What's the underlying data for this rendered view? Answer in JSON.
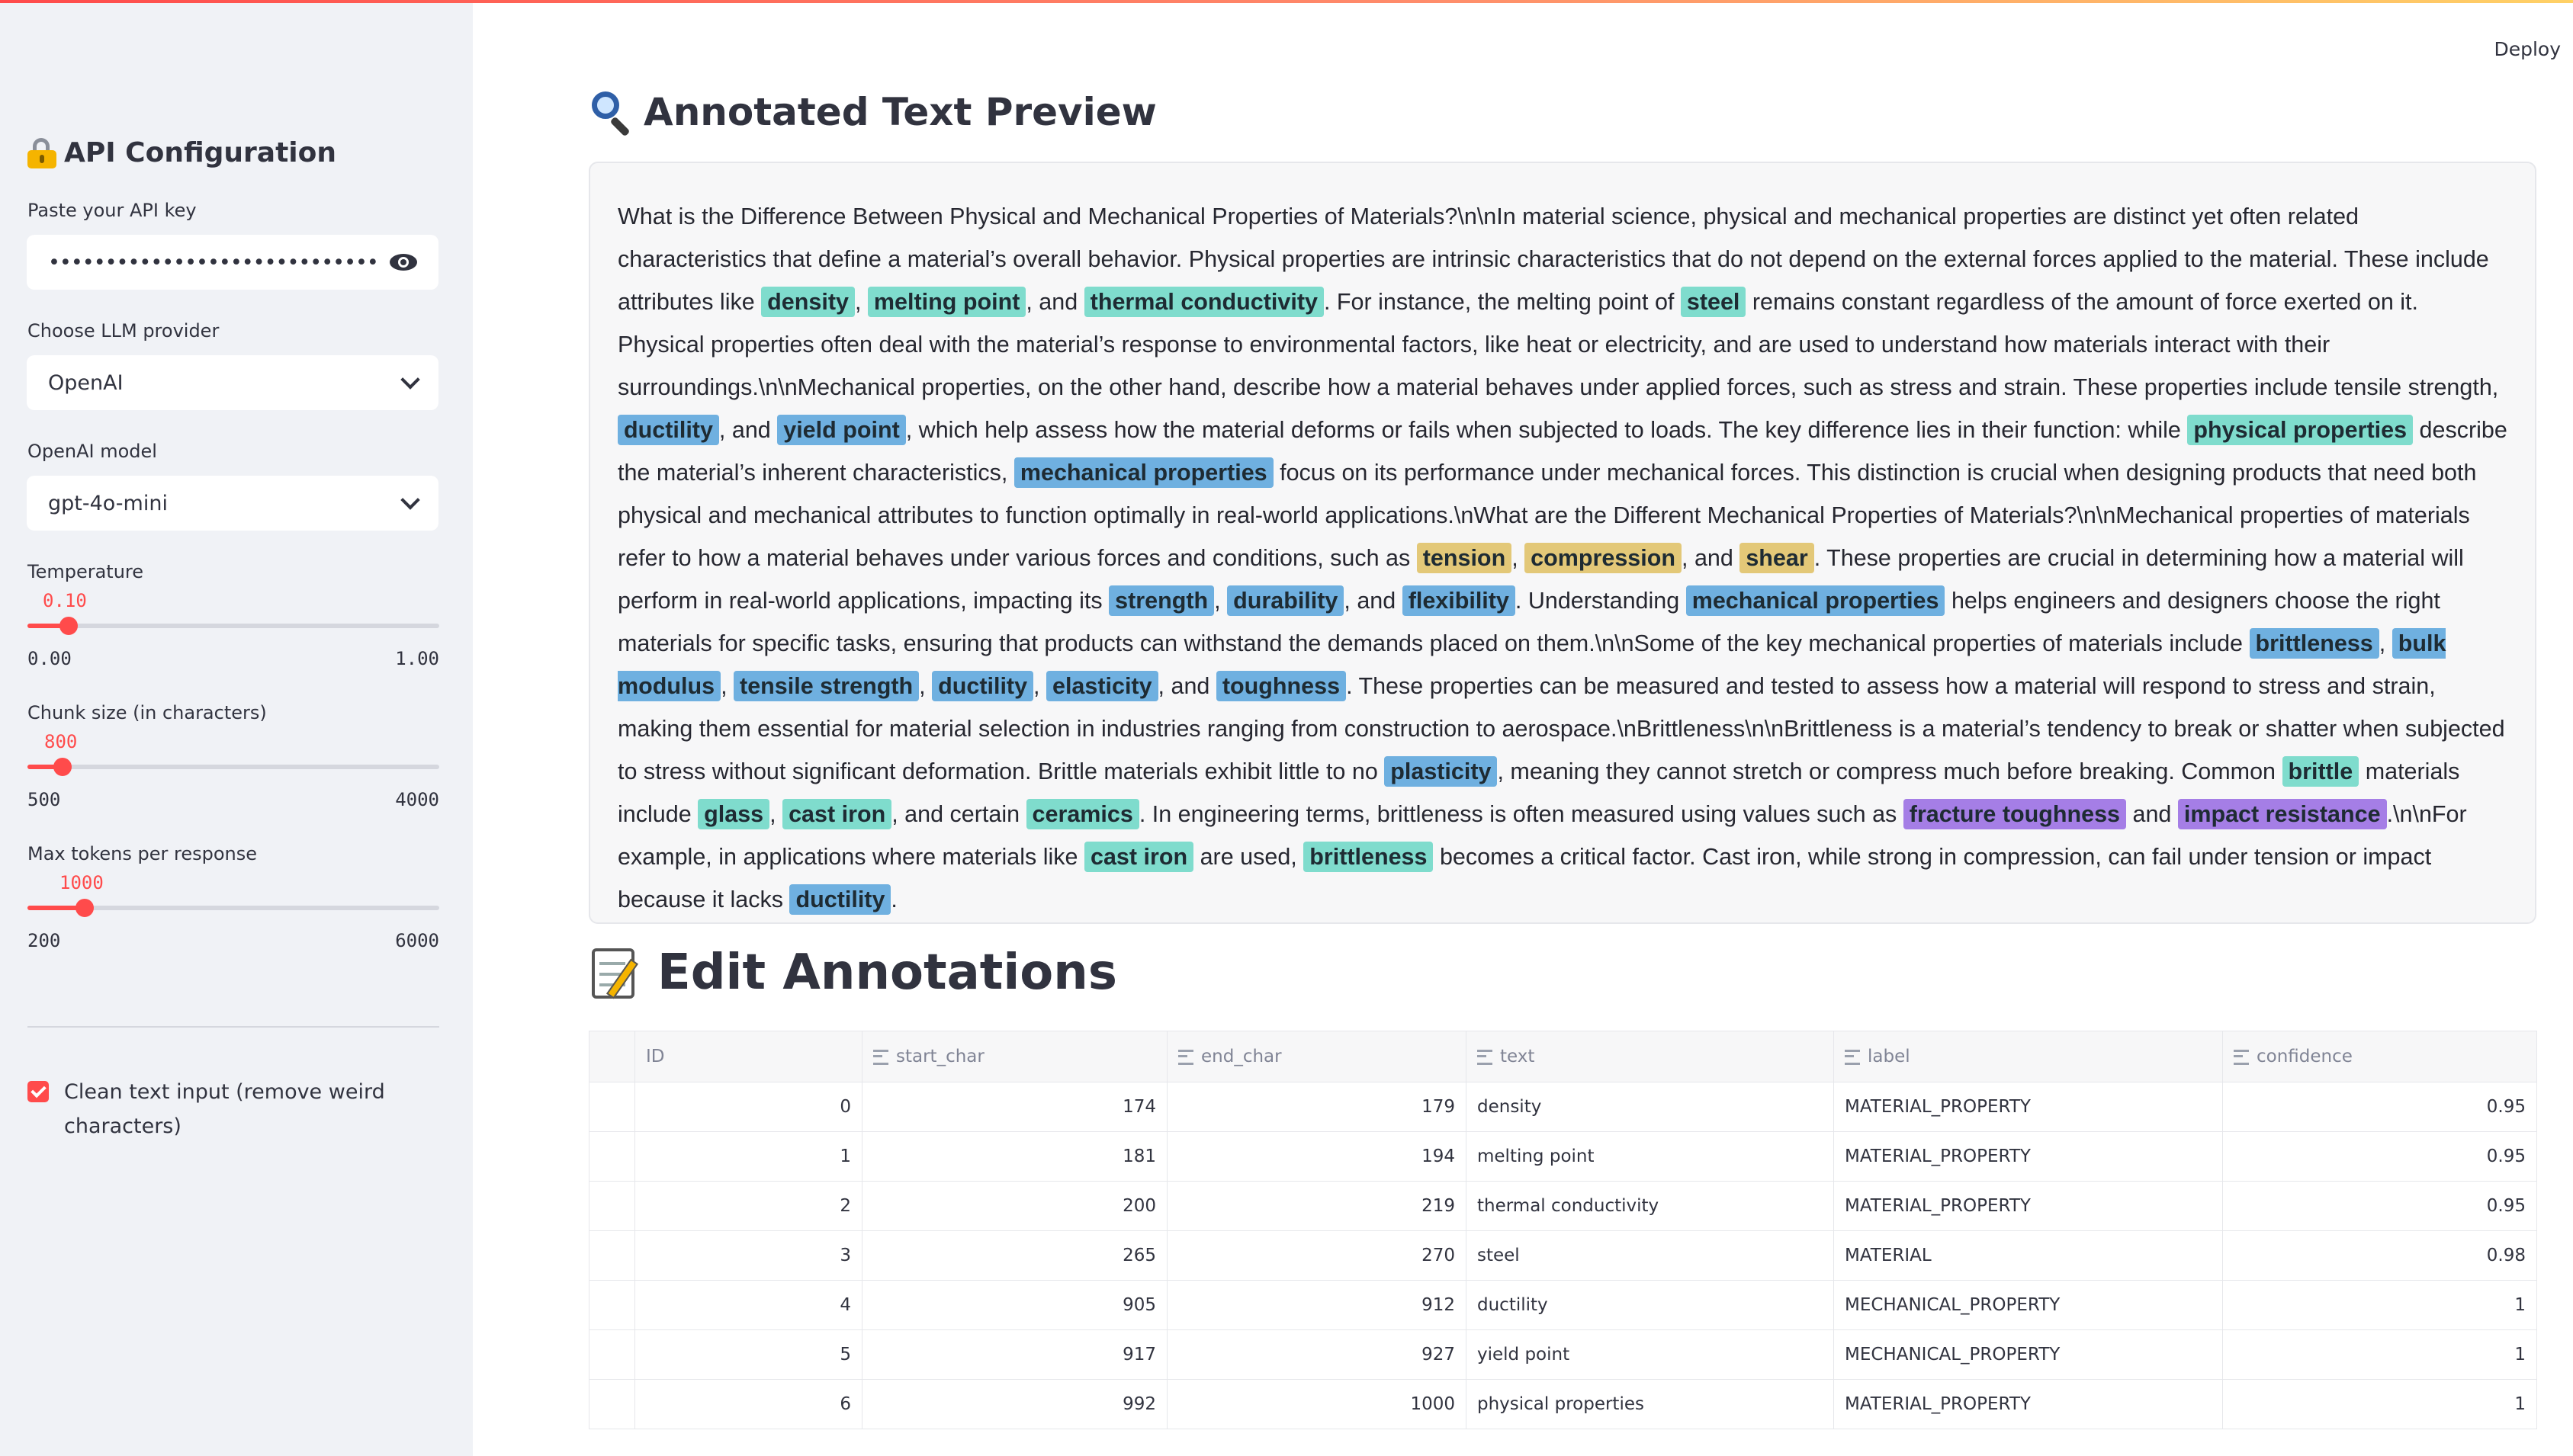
{
  "app": {
    "deploy_label": "Deploy"
  },
  "sidebar": {
    "title": "API Configuration",
    "api_key": {
      "label": "Paste your API key",
      "value": "••••••••••••••••••••••••••••••••••••••••••••••••••••"
    },
    "provider": {
      "label": "Choose LLM provider",
      "value": "OpenAI"
    },
    "model": {
      "label": "OpenAI model",
      "value": "gpt-4o-mini"
    },
    "temperature": {
      "label": "Temperature",
      "value": "0.10",
      "min": "0.00",
      "max": "1.00",
      "fraction": 0.1
    },
    "chunk_size": {
      "label": "Chunk size (in characters)",
      "value": "800",
      "min": "500",
      "max": "4000",
      "fraction": 0.0857
    },
    "max_tokens": {
      "label": "Max tokens per response",
      "value": "1000",
      "min": "200",
      "max": "6000",
      "fraction": 0.138
    },
    "clean_text": {
      "label": "Clean text input (remove weird characters)",
      "checked": true
    }
  },
  "preview": {
    "title": "Annotated Text Preview",
    "segments": [
      [
        "What is the Difference Between Physical and Mechanical Properties of Materials?\\n\\nIn material science, physical and mechanical properties are distinct yet often related characteristics that define a material’s overall behavior. Physical properties are intrinsic characteristics that do not depend on the external forces applied to the material. These include attributes like ",
        ""
      ],
      [
        "density",
        "mp"
      ],
      [
        ", ",
        ""
      ],
      [
        "melting point",
        "mp"
      ],
      [
        ", and ",
        ""
      ],
      [
        "thermal conductivity",
        "mp"
      ],
      [
        ". For instance, the melting point of ",
        ""
      ],
      [
        "steel",
        "me"
      ],
      [
        " remains constant regardless of the amount of force exerted on it. Physical properties often deal with the material’s response to environmental factors, like heat or electricity, and are used to understand how materials interact with their surroundings.\\n\\nMechanical properties, on the other hand, describe how a material behaves under applied forces, such as stress and strain. These properties include tensile strength, ",
        ""
      ],
      [
        "ductility",
        "mech"
      ],
      [
        ", and ",
        ""
      ],
      [
        "yield point",
        "mech"
      ],
      [
        ", which help assess how the material deforms or fails when subjected to loads. The key difference lies in their function: while ",
        ""
      ],
      [
        "physical properties",
        "mp"
      ],
      [
        " describe the material’s inherent characteristics, ",
        ""
      ],
      [
        "mechanical properties",
        "mech"
      ],
      [
        " focus on its performance under mechanical forces. This distinction is crucial when designing products that need both physical and mechanical attributes to function optimally in real-world applications.\\nWhat are the Different Mechanical Properties of Materials?\\n\\nMechanical properties of materials refer to how a material behaves under various forces and conditions, such as ",
        ""
      ],
      [
        "tension",
        "load"
      ],
      [
        ", ",
        ""
      ],
      [
        "compression",
        "load"
      ],
      [
        ", and ",
        ""
      ],
      [
        "shear",
        "load"
      ],
      [
        ". These properties are crucial in determining how a material will perform in real-world applications, impacting its ",
        ""
      ],
      [
        "strength",
        "mech"
      ],
      [
        ", ",
        ""
      ],
      [
        "durability",
        "mech"
      ],
      [
        ", and ",
        ""
      ],
      [
        "flexibility",
        "mech"
      ],
      [
        ". Understanding ",
        ""
      ],
      [
        "mechanical properties",
        "mech"
      ],
      [
        " helps engineers and designers choose the right materials for specific tasks, ensuring that products can withstand the demands placed on them.\\n\\nSome of the key mechanical properties of materials include ",
        ""
      ],
      [
        "brittleness",
        "mech"
      ],
      [
        ", ",
        ""
      ],
      [
        "bulk modulus",
        "mech"
      ],
      [
        ", ",
        ""
      ],
      [
        "tensile strength",
        "mech"
      ],
      [
        ", ",
        ""
      ],
      [
        "ductility",
        "mech"
      ],
      [
        ", ",
        ""
      ],
      [
        "elasticity",
        "mech"
      ],
      [
        ", and ",
        ""
      ],
      [
        "toughness",
        "mech"
      ],
      [
        ". These properties can be measured and tested to assess how a material will respond to stress and strain, making them essential for material selection in industries ranging from construction to aerospace.\\nBrittleness\\n\\nBrittleness is a material’s tendency to break or shatter when subjected to stress without significant deformation. Brittle materials exhibit little to no ",
        ""
      ],
      [
        "plasticity",
        "mech"
      ],
      [
        ", meaning they cannot stretch or compress much before breaking. Common ",
        ""
      ],
      [
        "brittle",
        "mp"
      ],
      [
        " materials include ",
        ""
      ],
      [
        "glass",
        "me"
      ],
      [
        ", ",
        ""
      ],
      [
        "cast iron",
        "me"
      ],
      [
        ", and certain ",
        ""
      ],
      [
        "ceramics",
        "me"
      ],
      [
        ". In engineering terms, brittleness is often measured using values such as ",
        ""
      ],
      [
        "fracture toughness",
        "test"
      ],
      [
        " and ",
        ""
      ],
      [
        "impact resistance",
        "test"
      ],
      [
        ".\\n\\nFor example, in applications where materials like ",
        ""
      ],
      [
        "cast iron",
        "me"
      ],
      [
        " are used, ",
        ""
      ],
      [
        "brittleness",
        "mp"
      ],
      [
        " becomes a critical factor. Cast iron, while strong in compression, can fail under tension or impact because it lacks ",
        ""
      ],
      [
        "ductility",
        "mech"
      ],
      [
        ".",
        ""
      ]
    ]
  },
  "annotations": {
    "title": "Edit Annotations",
    "columns": [
      "ID",
      "start_char",
      "end_char",
      "text",
      "label",
      "confidence"
    ],
    "rows": [
      [
        "0",
        "174",
        "179",
        "density",
        "MATERIAL_PROPERTY",
        "0.95"
      ],
      [
        "1",
        "181",
        "194",
        "melting point",
        "MATERIAL_PROPERTY",
        "0.95"
      ],
      [
        "2",
        "200",
        "219",
        "thermal conductivity",
        "MATERIAL_PROPERTY",
        "0.95"
      ],
      [
        "3",
        "265",
        "270",
        "steel",
        "MATERIAL",
        "0.98"
      ],
      [
        "4",
        "905",
        "912",
        "ductility",
        "MECHANICAL_PROPERTY",
        "1"
      ],
      [
        "5",
        "917",
        "927",
        "yield point",
        "MECHANICAL_PROPERTY",
        "1"
      ],
      [
        "6",
        "992",
        "1000",
        "physical properties",
        "MATERIAL_PROPERTY",
        "1"
      ]
    ]
  }
}
